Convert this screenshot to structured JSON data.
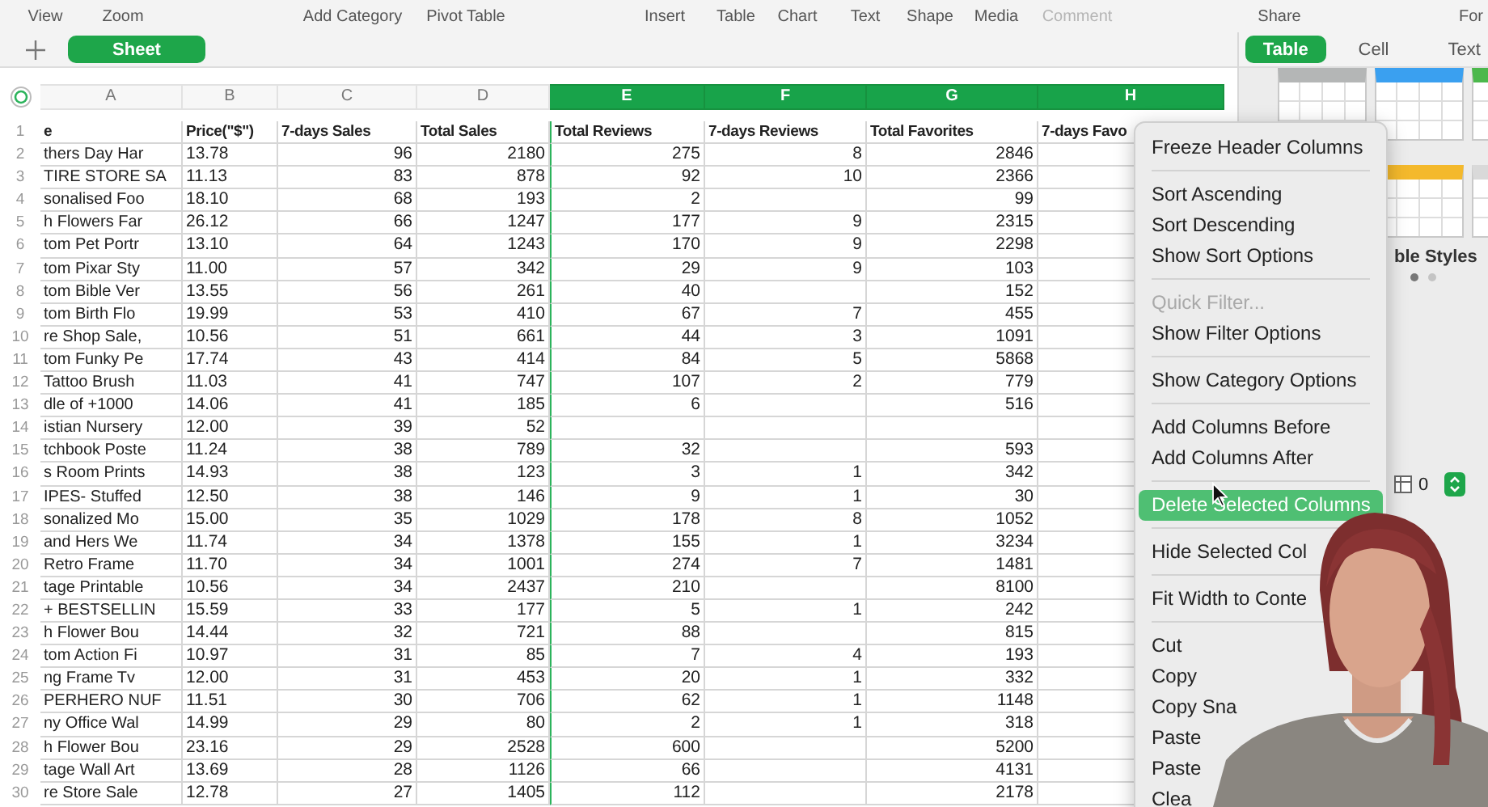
{
  "toolbar": [
    {
      "label": "View",
      "disabled": false
    },
    {
      "label": "Zoom",
      "disabled": false
    },
    {
      "label": "Add Category",
      "disabled": false
    },
    {
      "label": "Pivot Table",
      "disabled": false
    },
    {
      "label": "Insert",
      "disabled": false
    },
    {
      "label": "Table",
      "disabled": false
    },
    {
      "label": "Chart",
      "disabled": false
    },
    {
      "label": "Text",
      "disabled": false
    },
    {
      "label": "Shape",
      "disabled": false
    },
    {
      "label": "Media",
      "disabled": false
    },
    {
      "label": "Comment",
      "disabled": true
    },
    {
      "label": "Share",
      "disabled": false
    },
    {
      "label": "For",
      "disabled": false
    }
  ],
  "sheet_tabs": [
    {
      "label": "Sheet",
      "selected": true
    }
  ],
  "inspector": {
    "tabs": [
      {
        "label": "Table",
        "selected": true
      },
      {
        "label": "Cell",
        "selected": false
      },
      {
        "label": "Text",
        "selected": false
      }
    ],
    "table_style_rows": [
      {
        "styles": [
          {
            "color": "#b4b6b6"
          },
          {
            "color": "#3aa0f0"
          },
          {
            "color": "#4cb84c"
          }
        ]
      },
      {
        "styles": [
          {
            "color": "#f4b92c"
          },
          {
            "color": "#d9d9d9"
          }
        ]
      }
    ],
    "styles_label": "ble Styles",
    "style_pages": [
      {
        "selected": true
      },
      {
        "selected": false
      }
    ],
    "stepper": {
      "value": "0"
    }
  },
  "sheet": {
    "columns": [
      {
        "letter": "A",
        "selected": false
      },
      {
        "letter": "B",
        "selected": false
      },
      {
        "letter": "C",
        "selected": false
      },
      {
        "letter": "D",
        "selected": false
      },
      {
        "letter": "E",
        "selected": true
      },
      {
        "letter": "F",
        "selected": true
      },
      {
        "letter": "G",
        "selected": true
      },
      {
        "letter": "H",
        "selected": true
      }
    ],
    "rows": [
      {
        "num": "1",
        "kind": "header",
        "cells": [
          "e",
          "Price(\"$\")",
          "7-days Sales",
          "Total Sales",
          "Total Reviews",
          "7-days Reviews",
          "Total Favorites",
          "7-days Favo"
        ]
      },
      {
        "num": "2",
        "kind": "data",
        "cells": [
          "thers Day Har",
          "13.78",
          "96",
          "2180",
          "275",
          "8",
          "2846"
        ]
      },
      {
        "num": "3",
        "kind": "data",
        "cells": [
          "TIRE STORE SA",
          "11.13",
          "83",
          "878",
          "92",
          "10",
          "2366"
        ]
      },
      {
        "num": "4",
        "kind": "data",
        "cells": [
          "sonalised Foo",
          "18.10",
          "68",
          "193",
          "2",
          null,
          "99"
        ]
      },
      {
        "num": "5",
        "kind": "data",
        "cells": [
          "h Flowers Far",
          "26.12",
          "66",
          "1247",
          "177",
          "9",
          "2315"
        ]
      },
      {
        "num": "6",
        "kind": "data",
        "cells": [
          "tom Pet Portr",
          "13.10",
          "64",
          "1243",
          "170",
          "9",
          "2298"
        ]
      },
      {
        "num": "7",
        "kind": "data",
        "cells": [
          "tom Pixar Sty",
          "11.00",
          "57",
          "342",
          "29",
          "9",
          "103"
        ]
      },
      {
        "num": "8",
        "kind": "data",
        "cells": [
          "tom Bible Ver",
          "13.55",
          "56",
          "261",
          "40",
          null,
          "152"
        ]
      },
      {
        "num": "9",
        "kind": "data",
        "cells": [
          "tom Birth Flo",
          "19.99",
          "53",
          "410",
          "67",
          "7",
          "455"
        ]
      },
      {
        "num": "10",
        "kind": "data",
        "cells": [
          "re Shop Sale,",
          "10.56",
          "51",
          "661",
          "44",
          "3",
          "1091"
        ]
      },
      {
        "num": "11",
        "kind": "data",
        "cells": [
          "tom Funky Pe",
          "17.74",
          "43",
          "414",
          "84",
          "5",
          "5868"
        ]
      },
      {
        "num": "12",
        "kind": "data",
        "cells": [
          "Tattoo Brush",
          "11.03",
          "41",
          "747",
          "107",
          "2",
          "779"
        ]
      },
      {
        "num": "13",
        "kind": "data",
        "cells": [
          "dle of +1000",
          "14.06",
          "41",
          "185",
          "6",
          null,
          "516"
        ]
      },
      {
        "num": "14",
        "kind": "data",
        "cells": [
          "istian Nursery",
          "12.00",
          "39",
          "52",
          null,
          null,
          null
        ]
      },
      {
        "num": "15",
        "kind": "data",
        "cells": [
          "tchbook Poste",
          "11.24",
          "38",
          "789",
          "32",
          null,
          "593"
        ]
      },
      {
        "num": "16",
        "kind": "data",
        "cells": [
          "s Room Prints",
          "14.93",
          "38",
          "123",
          "3",
          "1",
          "342"
        ]
      },
      {
        "num": "17",
        "kind": "data",
        "cells": [
          "IPES- Stuffed",
          "12.50",
          "38",
          "146",
          "9",
          "1",
          "30"
        ]
      },
      {
        "num": "18",
        "kind": "data",
        "cells": [
          "sonalized Mo",
          "15.00",
          "35",
          "1029",
          "178",
          "8",
          "1052"
        ]
      },
      {
        "num": "19",
        "kind": "data",
        "cells": [
          "and Hers We",
          "11.74",
          "34",
          "1378",
          "155",
          "1",
          "3234"
        ]
      },
      {
        "num": "20",
        "kind": "data",
        "cells": [
          "Retro Frame",
          "11.70",
          "34",
          "1001",
          "274",
          "7",
          "1481"
        ]
      },
      {
        "num": "21",
        "kind": "data",
        "cells": [
          "tage Printable",
          "10.56",
          "34",
          "2437",
          "210",
          null,
          "8100"
        ]
      },
      {
        "num": "22",
        "kind": "data",
        "cells": [
          "+ BESTSELLIN",
          "15.59",
          "33",
          "177",
          "5",
          "1",
          "242"
        ]
      },
      {
        "num": "23",
        "kind": "data",
        "cells": [
          "h Flower Bou",
          "14.44",
          "32",
          "721",
          "88",
          null,
          "815"
        ]
      },
      {
        "num": "24",
        "kind": "data",
        "cells": [
          "tom Action Fi",
          "10.97",
          "31",
          "85",
          "7",
          "4",
          "193"
        ]
      },
      {
        "num": "25",
        "kind": "data",
        "cells": [
          "ng Frame Tv",
          "12.00",
          "31",
          "453",
          "20",
          "1",
          "332"
        ]
      },
      {
        "num": "26",
        "kind": "data",
        "cells": [
          "PERHERO NUF",
          "11.51",
          "30",
          "706",
          "62",
          "1",
          "1148"
        ]
      },
      {
        "num": "27",
        "kind": "data",
        "cells": [
          "ny Office Wal",
          "14.99",
          "29",
          "80",
          "2",
          "1",
          "318"
        ]
      },
      {
        "num": "28",
        "kind": "data",
        "cells": [
          "h Flower Bou",
          "23.16",
          "29",
          "2528",
          "600",
          null,
          "5200"
        ]
      },
      {
        "num": "29",
        "kind": "data",
        "cells": [
          "tage Wall Art",
          "13.69",
          "28",
          "1126",
          "66",
          null,
          "4131"
        ]
      },
      {
        "num": "30",
        "kind": "data",
        "cells": [
          "re Store Sale",
          "12.78",
          "27",
          "1405",
          "112",
          null,
          "2178"
        ]
      }
    ]
  },
  "context_menu": {
    "items": [
      {
        "kind": "item",
        "label": "Freeze Header Columns",
        "disabled": false,
        "selected": false
      },
      {
        "kind": "separator"
      },
      {
        "kind": "item",
        "label": "Sort Ascending",
        "disabled": false,
        "selected": false
      },
      {
        "kind": "item",
        "label": "Sort Descending",
        "disabled": false,
        "selected": false
      },
      {
        "kind": "item",
        "label": "Show Sort Options",
        "disabled": false,
        "selected": false
      },
      {
        "kind": "separator"
      },
      {
        "kind": "item",
        "label": "Quick Filter...",
        "disabled": true,
        "selected": false
      },
      {
        "kind": "item",
        "label": "Show Filter Options",
        "disabled": false,
        "selected": false
      },
      {
        "kind": "separator"
      },
      {
        "kind": "item",
        "label": "Show Category Options",
        "disabled": false,
        "selected": false
      },
      {
        "kind": "separator"
      },
      {
        "kind": "item",
        "label": "Add Columns Before",
        "disabled": false,
        "selected": false
      },
      {
        "kind": "item",
        "label": "Add Columns After",
        "disabled": false,
        "selected": false
      },
      {
        "kind": "separator"
      },
      {
        "kind": "item",
        "label": "Delete Selected Columns",
        "disabled": false,
        "selected": true
      },
      {
        "kind": "separator"
      },
      {
        "kind": "item",
        "label": "Hide Selected Col",
        "disabled": false,
        "selected": false
      },
      {
        "kind": "separator"
      },
      {
        "kind": "item",
        "label": "Fit Width to Conte",
        "disabled": false,
        "selected": false
      },
      {
        "kind": "separator"
      },
      {
        "kind": "item",
        "label": "Cut",
        "disabled": false,
        "selected": false
      },
      {
        "kind": "item",
        "label": "Copy",
        "disabled": false,
        "selected": false
      },
      {
        "kind": "item",
        "label": "Copy Sna",
        "disabled": false,
        "selected": false
      },
      {
        "kind": "item",
        "label": "Paste",
        "disabled": false,
        "selected": false
      },
      {
        "kind": "item",
        "label": "Paste",
        "disabled": false,
        "selected": false
      },
      {
        "kind": "item",
        "label": "Clea",
        "disabled": false,
        "selected": false
      }
    ]
  }
}
